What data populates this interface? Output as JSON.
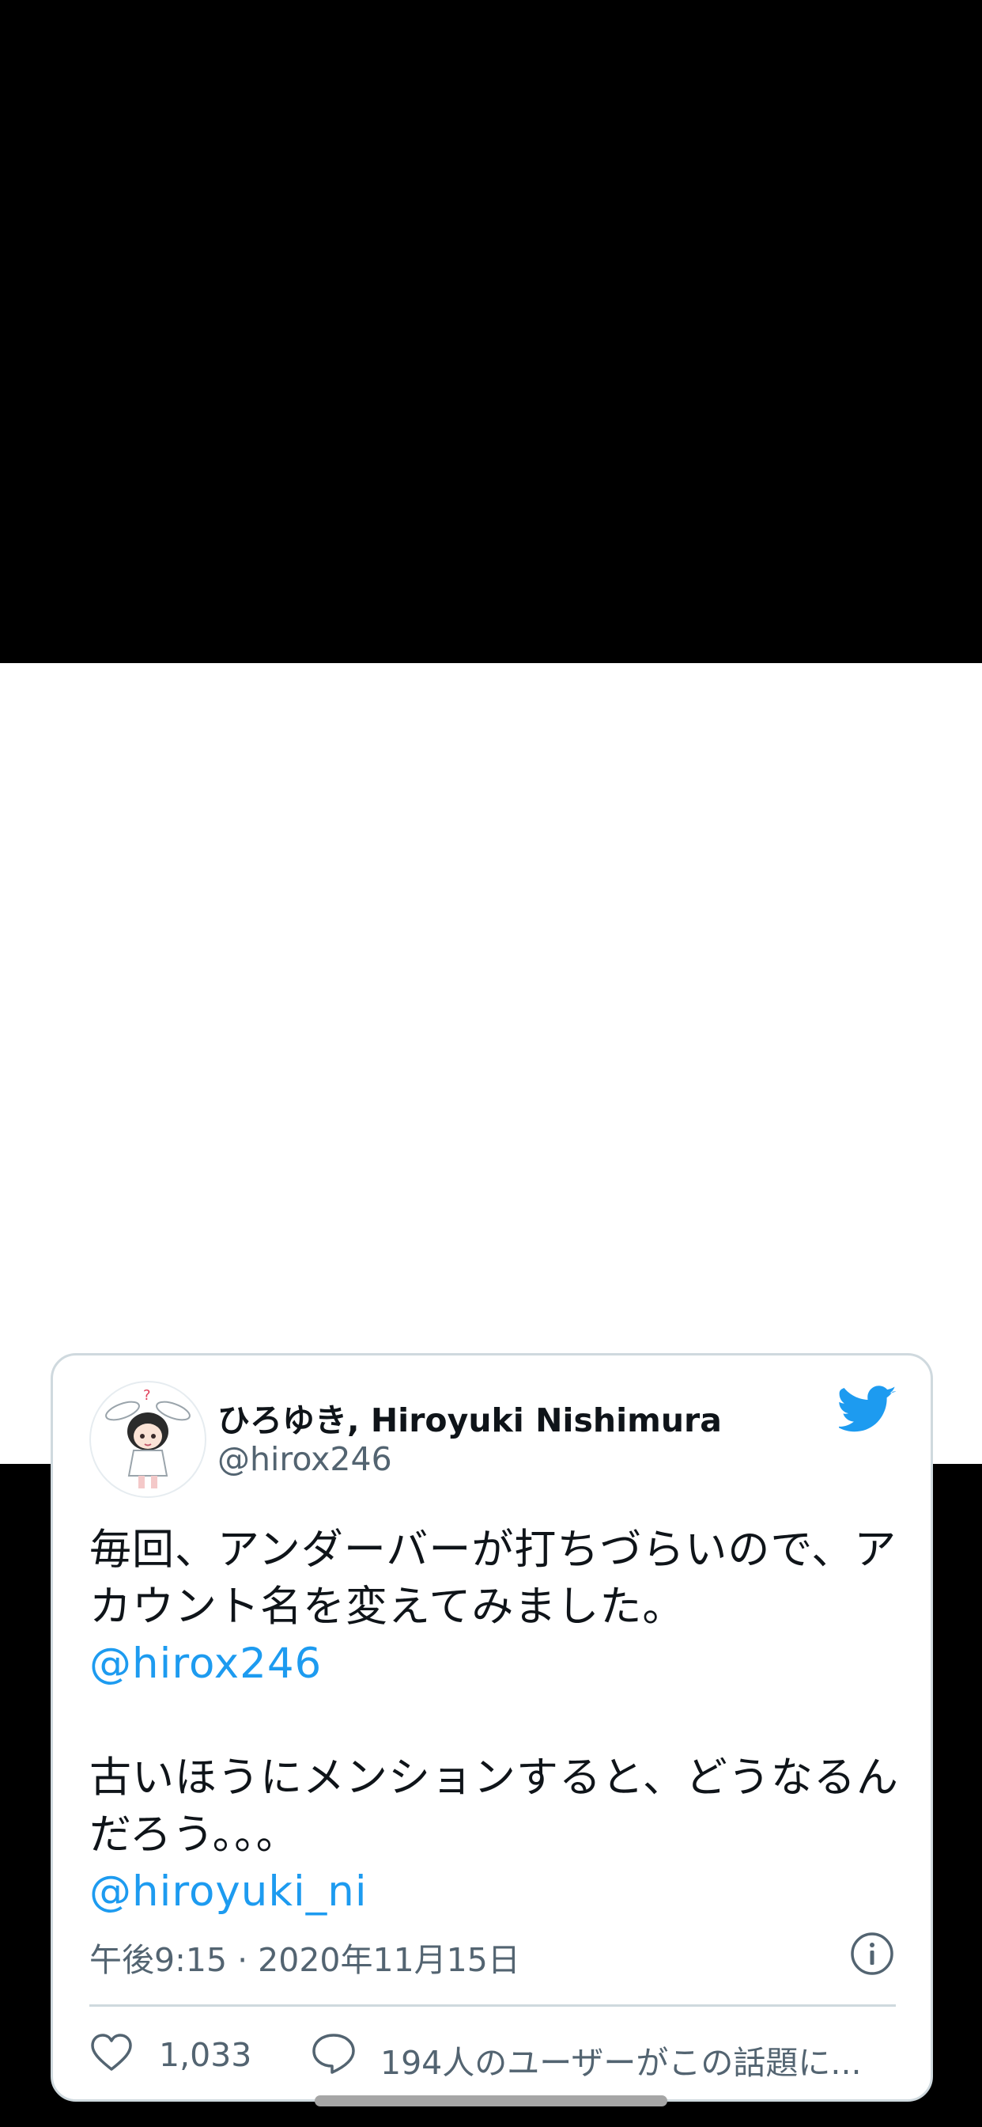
{
  "tweet": {
    "display_name": "ひろゆき, Hiroyuki Nishimura",
    "handle": "@hirox246",
    "text_lines": [
      "毎回、アンダーバーが打ちづらいので、ア",
      "カウント名を変えてみました。"
    ],
    "mention_1": "@hirox246",
    "text_lines_2": [
      "古いほうにメンションすると、どうなるん",
      "だろう。。。"
    ],
    "mention_2": "@hiroyuki_ni",
    "timestamp": "午後9:15 · 2020年11月15日",
    "like_count": "1,033",
    "reply_text": "194人のユーザーがこの話題に..."
  },
  "icons": {
    "avatar": "avatar-illustration",
    "logo": "twitter-bird-icon",
    "info": "info-icon",
    "like": "heart-icon",
    "reply": "speech-bubble-icon"
  },
  "colors": {
    "link": "#1d9bf0",
    "twitter_blue": "#1d9bf0",
    "muted": "#536471",
    "text": "#0f1419",
    "border": "#cfd9de"
  }
}
